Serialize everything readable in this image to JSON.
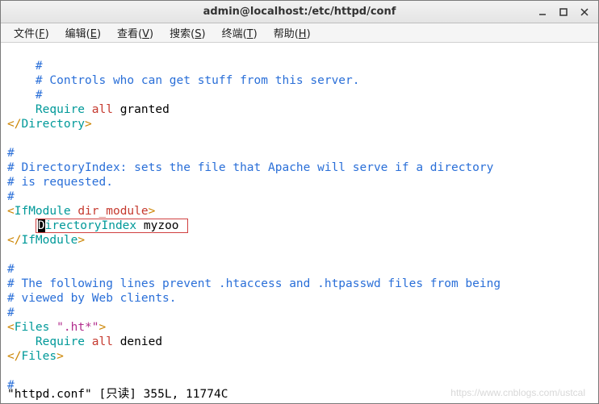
{
  "window": {
    "title": "admin@localhost:/etc/httpd/conf"
  },
  "menu": {
    "file": {
      "label": "文件",
      "accel": "F"
    },
    "edit": {
      "label": "编辑",
      "accel": "E"
    },
    "view": {
      "label": "查看",
      "accel": "V"
    },
    "search": {
      "label": "搜索",
      "accel": "S"
    },
    "term": {
      "label": "终端",
      "accel": "T"
    },
    "help": {
      "label": "帮助",
      "accel": "H"
    }
  },
  "code": {
    "l01": "    #",
    "l02": "    # Controls who can get stuff from this server.",
    "l03": "    #",
    "req_kw": "Require",
    "req_arg1": "all",
    "req_arg2": "granted",
    "close_dir_open": "</",
    "close_dir_name": "Directory",
    "close_dir_end": ">",
    "c1": "#",
    "c2": "# DirectoryIndex: sets the file that Apache will serve if a directory",
    "c3": "# is requested.",
    "c4": "#",
    "ifmod_open": "<",
    "ifmod_name": "IfModule",
    "ifmod_arg": "dir_module",
    "ifmod_end": ">",
    "di_first": "D",
    "di_rest": "irectoryIndex",
    "di_val": "myzoo",
    "ifmod_close_open": "</",
    "ifmod_close_name": "IfModule",
    "ifmod_close_end": ">",
    "d1": "#",
    "d2": "# The following lines prevent .htaccess and .htpasswd files from being",
    "d3": "# viewed by Web clients.",
    "d4": "#",
    "files_open": "<",
    "files_name": "Files",
    "files_arg": "\".ht*\"",
    "files_end": ">",
    "req2_kw": "Require",
    "req2_arg1": "all",
    "req2_arg2": "denied",
    "files_close_open": "</",
    "files_close_name": "Files",
    "files_close_end": ">",
    "last": "#"
  },
  "status": {
    "text": "\"httpd.conf\" [只读] 355L, 11774C"
  },
  "watermark": "https://www.cnblogs.com/ustcal"
}
